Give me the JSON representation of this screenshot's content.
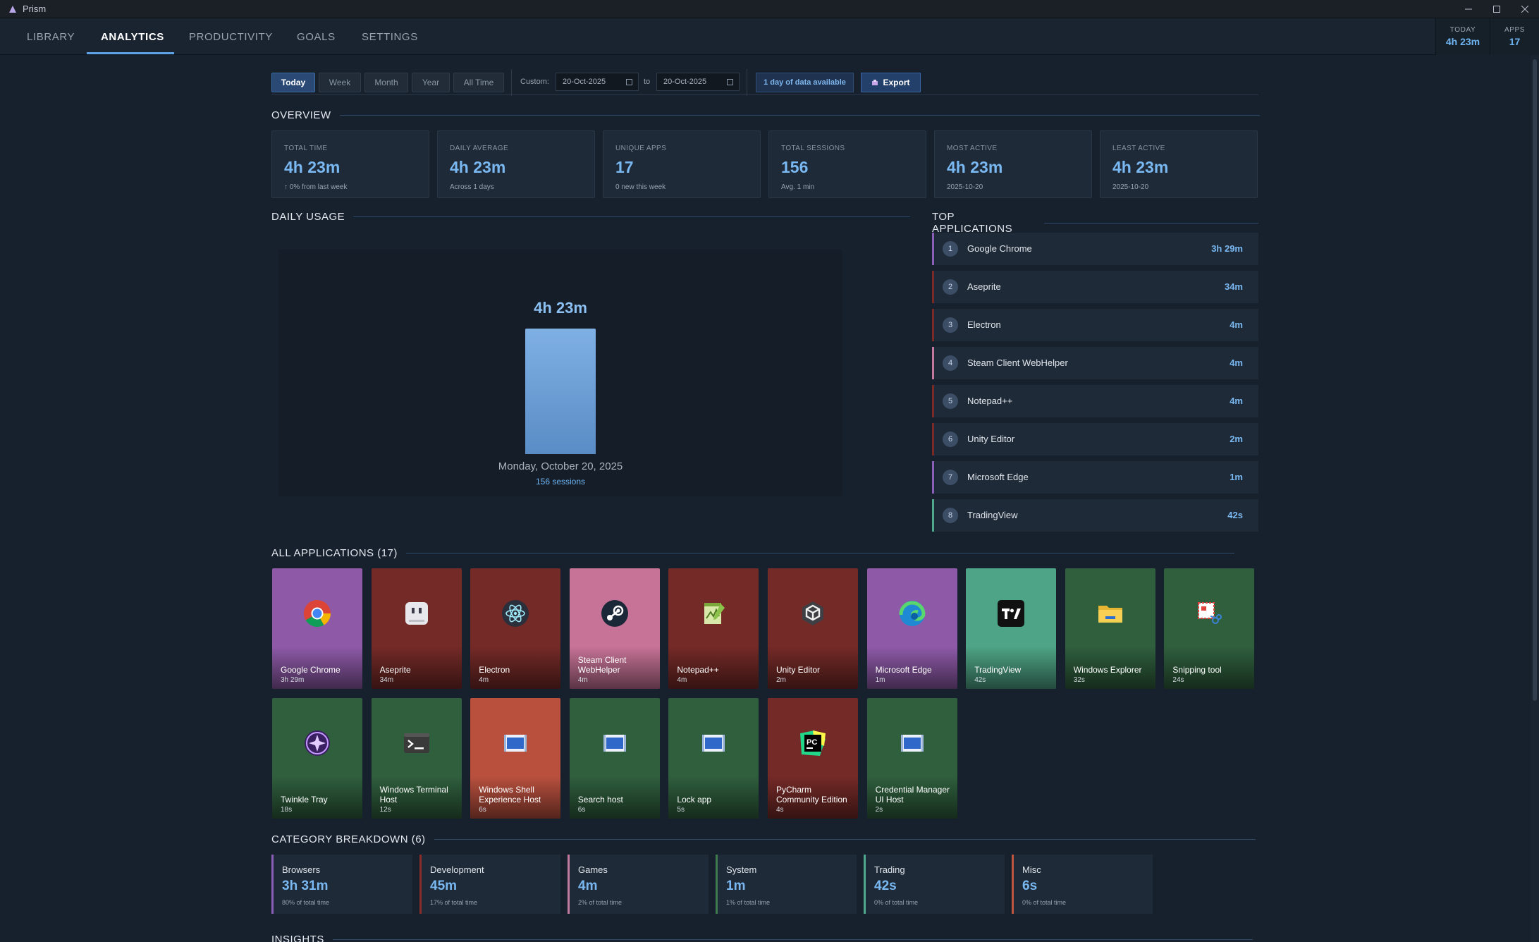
{
  "window": {
    "title": "Prism"
  },
  "nav": {
    "tabs": [
      "LIBRARY",
      "ANALYTICS",
      "PRODUCTIVITY",
      "GOALS",
      "SETTINGS"
    ],
    "active": "ANALYTICS",
    "today_label": "TODAY",
    "today_value": "4h 23m",
    "apps_label": "APPS",
    "apps_value": "17"
  },
  "filters": {
    "ranges": [
      "Today",
      "Week",
      "Month",
      "Year",
      "All Time"
    ],
    "active": "Today",
    "custom_label": "Custom:",
    "from_date": "20-Oct-2025",
    "to_label": "to",
    "to_date": "20-Oct-2025",
    "availability": "1 day of data available",
    "export_label": "Export"
  },
  "overview": {
    "heading": "OVERVIEW",
    "cards": [
      {
        "label": "TOTAL TIME",
        "value": "4h 23m",
        "sub": "↑ 0% from last week"
      },
      {
        "label": "DAILY AVERAGE",
        "value": "4h 23m",
        "sub": "Across 1 days"
      },
      {
        "label": "UNIQUE APPS",
        "value": "17",
        "sub": "0 new this week"
      },
      {
        "label": "TOTAL SESSIONS",
        "value": "156",
        "sub": "Avg. 1 min"
      },
      {
        "label": "MOST ACTIVE",
        "value": "4h 23m",
        "sub": "2025-10-20"
      },
      {
        "label": "LEAST ACTIVE",
        "value": "4h 23m",
        "sub": "2025-10-20"
      }
    ]
  },
  "daily_usage": {
    "heading": "DAILY USAGE",
    "bar_value": "4h 23m",
    "date": "Monday, October 20, 2025",
    "sessions": "156 sessions"
  },
  "chart_data": {
    "type": "bar",
    "categories": [
      "Monday, October 20, 2025"
    ],
    "values": [
      263
    ],
    "data_labels": [
      "4h 23m"
    ],
    "annotations": [
      "156 sessions"
    ],
    "ylim": [
      0,
      263
    ]
  },
  "top_apps": {
    "heading": "TOP APPLICATIONS",
    "items": [
      {
        "rank": "1",
        "name": "Google Chrome",
        "time": "3h 29m",
        "color": "#8a5fb8"
      },
      {
        "rank": "2",
        "name": "Aseprite",
        "time": "34m",
        "color": "#7a2a26"
      },
      {
        "rank": "3",
        "name": "Electron",
        "time": "4m",
        "color": "#7a2a26"
      },
      {
        "rank": "4",
        "name": "Steam Client WebHelper",
        "time": "4m",
        "color": "#c47a9f"
      },
      {
        "rank": "5",
        "name": "Notepad++",
        "time": "4m",
        "color": "#7a2a26"
      },
      {
        "rank": "6",
        "name": "Unity Editor",
        "time": "2m",
        "color": "#7a2a26"
      },
      {
        "rank": "7",
        "name": "Microsoft Edge",
        "time": "1m",
        "color": "#8a5fb8"
      },
      {
        "rank": "8",
        "name": "TradingView",
        "time": "42s",
        "color": "#4fa88e"
      }
    ]
  },
  "all_apps": {
    "heading": "ALL APPLICATIONS (17)",
    "items": [
      {
        "name": "Google Chrome",
        "time": "3h 29m",
        "color": "#8e5aa8",
        "icon": "chrome-icon"
      },
      {
        "name": "Aseprite",
        "time": "34m",
        "color": "#742a27",
        "icon": "aseprite-icon"
      },
      {
        "name": "Electron",
        "time": "4m",
        "color": "#742a27",
        "icon": "electron-icon"
      },
      {
        "name": "Steam Client WebHelper",
        "time": "4m",
        "color": "#c77397",
        "icon": "steam-icon"
      },
      {
        "name": "Notepad++",
        "time": "4m",
        "color": "#742a27",
        "icon": "notepad-icon"
      },
      {
        "name": "Unity Editor",
        "time": "2m",
        "color": "#742a27",
        "icon": "unity-icon"
      },
      {
        "name": "Microsoft Edge",
        "time": "1m",
        "color": "#8e5aa8",
        "icon": "edge-icon"
      },
      {
        "name": "TradingView",
        "time": "42s",
        "color": "#4ea486",
        "icon": "tradingview-icon"
      },
      {
        "name": "Windows Explorer",
        "time": "32s",
        "color": "#2f5f3d",
        "icon": "folder-icon"
      },
      {
        "name": "Snipping tool",
        "time": "24s",
        "color": "#2f5f3d",
        "icon": "snipping-icon"
      },
      {
        "name": "Twinkle Tray",
        "time": "18s",
        "color": "#2f5f3d",
        "icon": "twinkle-icon"
      },
      {
        "name": "Windows Terminal Host",
        "time": "12s",
        "color": "#2f5f3d",
        "icon": "terminal-icon"
      },
      {
        "name": "Windows Shell Experience Host",
        "time": "6s",
        "color": "#b9503e",
        "icon": "window-icon"
      },
      {
        "name": "Search host",
        "time": "6s",
        "color": "#2f5f3d",
        "icon": "window-icon"
      },
      {
        "name": "Lock app",
        "time": "5s",
        "color": "#2f5f3d",
        "icon": "window-icon"
      },
      {
        "name": "PyCharm Community Edition",
        "time": "4s",
        "color": "#742a27",
        "icon": "pycharm-icon"
      },
      {
        "name": "Credential Manager UI Host",
        "time": "2s",
        "color": "#2f5f3d",
        "icon": "window-icon"
      }
    ]
  },
  "categories": {
    "heading": "CATEGORY BREAKDOWN (6)",
    "items": [
      {
        "name": "Browsers",
        "value": "3h 31m",
        "sub": "80% of total time",
        "color": "#8a5fb8"
      },
      {
        "name": "Development",
        "value": "45m",
        "sub": "17% of total time",
        "color": "#8a2c2a"
      },
      {
        "name": "Games",
        "value": "4m",
        "sub": "2% of total time",
        "color": "#c47a9f"
      },
      {
        "name": "System",
        "value": "1m",
        "sub": "1% of total time",
        "color": "#3f7a4d"
      },
      {
        "name": "Trading",
        "value": "42s",
        "sub": "0% of total time",
        "color": "#4fa88e"
      },
      {
        "name": "Misc",
        "value": "6s",
        "sub": "0% of total time",
        "color": "#c0553f"
      }
    ]
  },
  "insights": {
    "heading": "INSIGHTS"
  }
}
